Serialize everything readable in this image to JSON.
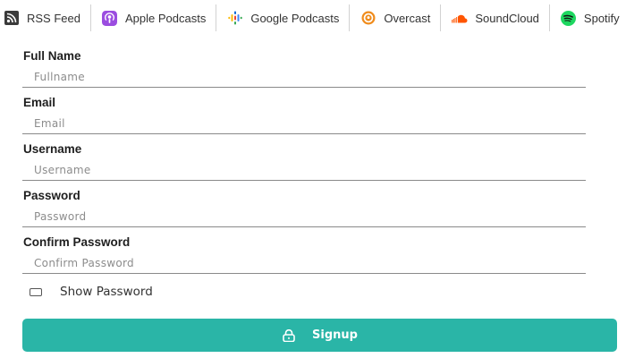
{
  "platforms": [
    {
      "label": "RSS Feed",
      "icon": "rss-icon"
    },
    {
      "label": "Apple Podcasts",
      "icon": "apple-podcasts-icon"
    },
    {
      "label": "Google Podcasts",
      "icon": "google-podcasts-icon"
    },
    {
      "label": "Overcast",
      "icon": "overcast-icon"
    },
    {
      "label": "SoundCloud",
      "icon": "soundcloud-icon"
    },
    {
      "label": "Spotify",
      "icon": "spotify-icon"
    }
  ],
  "form": {
    "full_name": {
      "label": "Full Name",
      "placeholder": "Fullname",
      "value": ""
    },
    "email": {
      "label": "Email",
      "placeholder": "Email",
      "value": ""
    },
    "username": {
      "label": "Username",
      "placeholder": "Username",
      "value": ""
    },
    "password": {
      "label": "Password",
      "placeholder": "Password",
      "value": ""
    },
    "confirm_password": {
      "label": "Confirm Password",
      "placeholder": "Confirm Password",
      "value": ""
    },
    "show_password": {
      "label": "Show Password",
      "checked": false
    },
    "signup_label": "Signup",
    "signup_icon": "lock-icon"
  },
  "colors": {
    "accent": "#2ab5a7",
    "apple": "#9b4de0",
    "overcast": "#f08c1c",
    "soundcloud": "#ff5500",
    "spotify": "#1ed760"
  }
}
